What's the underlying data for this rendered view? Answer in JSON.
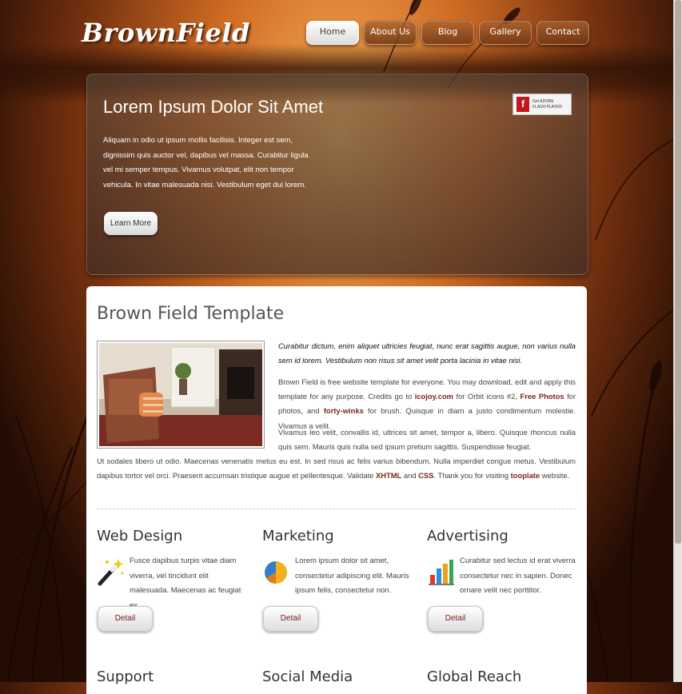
{
  "logo": "BrownField",
  "nav": {
    "items": [
      "Home",
      "About Us",
      "Blog",
      "Gallery",
      "Contact"
    ],
    "active": "Home"
  },
  "hero": {
    "title": "Lorem Ipsum Dolor Sit Amet",
    "text": "Aliquam in odio ut ipsum mollis facilisis. Integer est sem, dignissim quis auctor vel, dapibus vel massa. Curabitur ligula vel mi semper tempus. Vivamus volutpat, elit non tempor vehicula. In vitae malesuada nisi. Vestibulum eget dui lorem.",
    "flash_badge": {
      "line1": "Get ADOBE",
      "line2": "FLASH PLAYER"
    },
    "button": "Learn More"
  },
  "content": {
    "title": "Brown Field Template",
    "intro": "Curabitur dictum, enim aliquet ultricies feugiat, nunc erat sagittis augue, non varius nulla sem id lorem. Vestibulum non risus sit amet velit porta lacinia in vitae nisi.",
    "p1": {
      "t1": "Brown Field is free website template for everyone. You may download, edit and apply this template for any purpose. Credits go to ",
      "link1": "icojoy.com",
      "t2": " for Orbit icons #2, ",
      "link2": "Free Photos",
      "t3": " for photos, and ",
      "link3": "forty-winks",
      "t4": " for brush. Quisque in diam a justo condimentum molestie. Vivamus a velit."
    },
    "p2": {
      "t1": "Vivamus leo velit, convallis id, ultrices sit amet, tempor a, libero. Quisque rhoncus nulla quis sem. Mauris quis nulla sed ipsum pretium sagittis. Suspendisse feugiat.",
      "t2": "Ut sodales libero ut odio. Maecenas venenatis metus eu est. In sed risus ac felis varius bibendum. Nulla imperdiet congue metus. Vestibulum dapibus tortor vel orci. Praesent accumsan tristique augue et pellentesque. Validate ",
      "link1": "XHTML",
      "t3": " and ",
      "link2": "CSS",
      "t4": ". Thank you for visiting ",
      "link3": "tooplate",
      "t5": " website."
    }
  },
  "services": [
    {
      "title": "Web Design",
      "icon": "magic-wand-icon",
      "text": "Fusce dapibus turpis vitae diam viverra, vel tincidunt elit malesuada. Maecenas ac feugiat ex.",
      "button": "Detail"
    },
    {
      "title": "Marketing",
      "icon": "pie-chart-icon",
      "text": "Lorem ipsum dolor sit amet, consectetur adipiscing elit. Mauris ipsum felis, consectetur non.",
      "button": "Detail"
    },
    {
      "title": "Advertising",
      "icon": "bar-chart-icon",
      "text": "Curabitur sed lectus id erat viverra consectetur nec in sapien. Donec ornare velit nec porttitor.",
      "button": "Detail"
    }
  ],
  "services_row2": [
    "Support",
    "Social Media",
    "Global Reach"
  ],
  "colors": {
    "accent_link": "#7a2818",
    "background_sunset": "#e07a28"
  }
}
